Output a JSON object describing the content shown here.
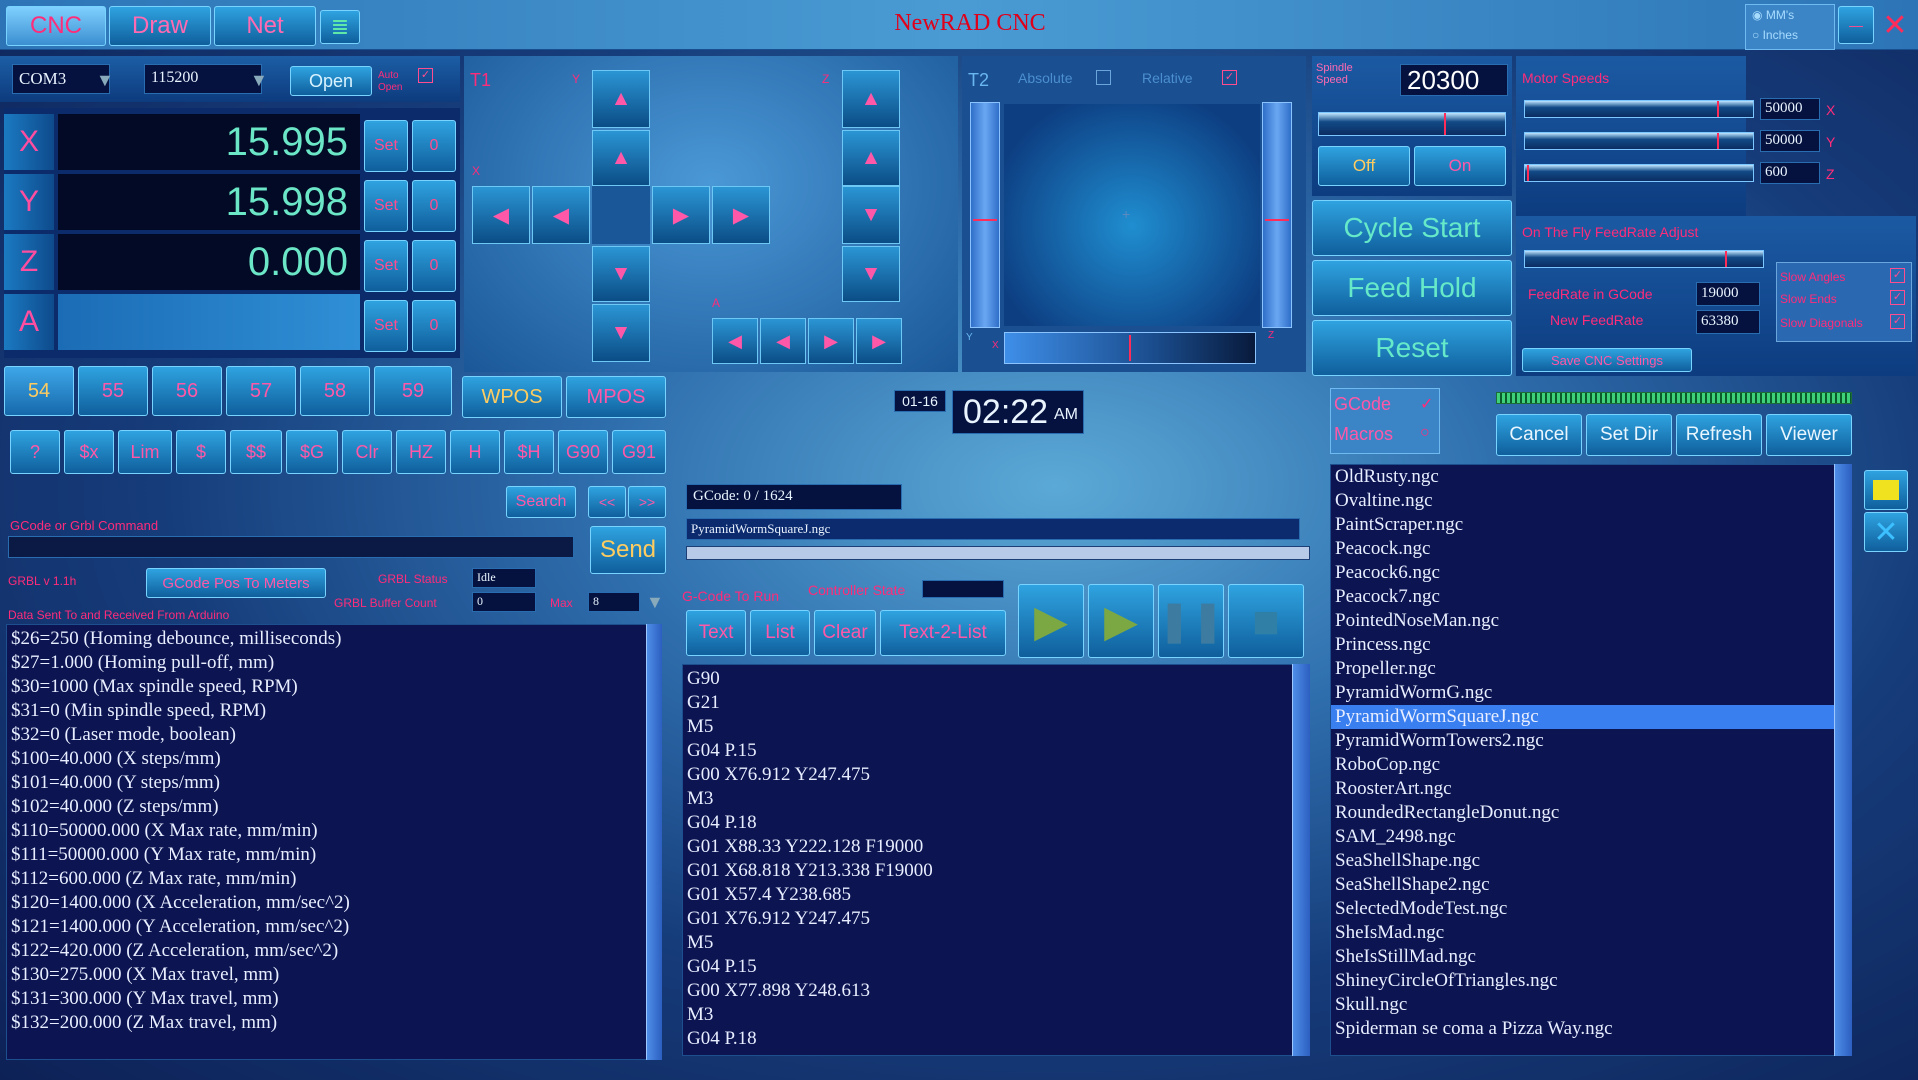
{
  "title": "NewRAD CNC",
  "tabs": [
    "CNC",
    "Draw",
    "Net"
  ],
  "units": {
    "mm": "MM's",
    "inches": "Inches"
  },
  "connection": {
    "port": "COM3",
    "baud": "115200",
    "open": "Open",
    "auto_open": "Auto Open"
  },
  "axes": [
    {
      "name": "X",
      "value": "15.995",
      "set": "Set",
      "zero": "0"
    },
    {
      "name": "Y",
      "value": "15.998",
      "set": "Set",
      "zero": "0"
    },
    {
      "name": "Z",
      "value": "0.000",
      "set": "Set",
      "zero": "0"
    },
    {
      "name": "A",
      "value": "",
      "set": "Set",
      "zero": "0"
    }
  ],
  "wcs": [
    "54",
    "55",
    "56",
    "57",
    "58",
    "59"
  ],
  "wpos": "WPOS",
  "mpos": "MPOS",
  "cmd_buttons": [
    "?",
    "$x",
    "Lim",
    "$",
    "$$",
    "$G",
    "Clr",
    "HZ",
    "H",
    "$H",
    "G90",
    "G91"
  ],
  "jog": {
    "t1": "T1",
    "t2": "T2",
    "y": "Y",
    "x": "X",
    "z": "Z",
    "a": "A",
    "absolute": "Absolute",
    "relative": "Relative"
  },
  "spindle": {
    "label": "Spindle Speed",
    "value": "20300",
    "off": "Off",
    "on": "On",
    "level": 0.68
  },
  "motor": {
    "label": "Motor Speeds",
    "rows": [
      {
        "value": "50000",
        "axis": "X"
      },
      {
        "value": "50000",
        "axis": "Y"
      },
      {
        "value": "600",
        "axis": "Z"
      }
    ]
  },
  "cycle": {
    "start": "Cycle Start",
    "hold": "Feed Hold",
    "reset": "Reset"
  },
  "feed": {
    "adjust": "On The Fly FeedRate Adjust",
    "in_gcode_label": "FeedRate in GCode",
    "in_gcode": "19000",
    "new_label": "New FeedRate",
    "new": "63380",
    "save": "Save CNC Settings",
    "slow_angles": "Slow Angles",
    "slow_ends": "Slow Ends",
    "slow_diagonals": "Slow Diagonals"
  },
  "search": {
    "button": "Search",
    "prev": "<<",
    "next": ">>"
  },
  "command": {
    "label": "GCode or Grbl Command",
    "send": "Send"
  },
  "grbl": {
    "version": "GRBL v 1.1h",
    "pos_to_meters": "GCode Pos To Meters",
    "status_label": "GRBL Status",
    "status": "Idle",
    "buffer_label": "GRBL Buffer Count",
    "buffer": "0",
    "max_label": "Max",
    "max": "8"
  },
  "data_label": "Data Sent To and Received From Arduino",
  "console": [
    "$26=250 (Homing debounce, milliseconds)",
    "$27=1.000 (Homing pull-off, mm)",
    "$30=1000 (Max spindle speed, RPM)",
    "$31=0 (Min spindle speed, RPM)",
    "$32=0 (Laser mode, boolean)",
    "$100=40.000 (X steps/mm)",
    "$101=40.000 (Y steps/mm)",
    "$102=40.000 (Z steps/mm)",
    "$110=50000.000 (X Max rate, mm/min)",
    "$111=50000.000 (Y Max rate, mm/min)",
    "$112=600.000 (Z Max rate, mm/min)",
    "$120=1400.000 (X Acceleration, mm/sec^2)",
    "$121=1400.000 (Y Acceleration, mm/sec^2)",
    "$122=420.000 (Z Acceleration, mm/sec^2)",
    "$130=275.000 (X Max travel, mm)",
    "$131=300.000 (Y Max travel, mm)",
    "$132=200.000 (Z Max travel, mm)"
  ],
  "clock": {
    "date": "01-16",
    "time": "02:22",
    "ampm": "AM"
  },
  "gcode": {
    "progress": "GCode: 0 / 1624",
    "file": "PyramidWormSquareJ.ngc",
    "to_run": "G-Code To Run",
    "controller_state": "Controller State",
    "text": "Text",
    "list": "List",
    "clear": "Clear",
    "text2list": "Text-2-List",
    "lines": [
      "G90",
      "G21",
      "M5",
      "G04 P.15",
      "G00 X76.912 Y247.475",
      "M3",
      "G04 P.18",
      "G01 X88.33 Y222.128 F19000",
      "G01 X68.818 Y213.338 F19000",
      "G01 X57.4 Y238.685",
      "G01 X76.912 Y247.475",
      "M5",
      "G04 P.15",
      "G00 X77.898 Y248.613",
      "M3",
      "G04 P.18"
    ]
  },
  "files": {
    "gcode": "GCode",
    "macros": "Macros",
    "cancel": "Cancel",
    "set_dir": "Set Dir",
    "refresh": "Refresh",
    "viewer": "Viewer",
    "items": [
      "OldRusty.ngc",
      "Ovaltine.ngc",
      "PaintScraper.ngc",
      "Peacock.ngc",
      "Peacock6.ngc",
      "Peacock7.ngc",
      "PointedNoseMan.ngc",
      "Princess.ngc",
      "Propeller.ngc",
      "PyramidWormG.ngc",
      "PyramidWormSquareJ.ngc",
      "PyramidWormTowers2.ngc",
      "RoboCop.ngc",
      "RoosterArt.ngc",
      "RoundedRectangleDonut.ngc",
      "SAM_2498.ngc",
      "SeaShellShape.ngc",
      "SeaShellShape2.ngc",
      "SelectedModeTest.ngc",
      "SheIsMad.ngc",
      "SheIsStillMad.ngc",
      "ShineyCircleOfTriangles.ngc",
      "Skull.ngc",
      "Spiderman se coma a Pizza Way.ngc"
    ],
    "selected": "PyramidWormSquareJ.ngc"
  },
  "colors": {
    "accent": "#ff2c7a",
    "value": "#6be6c6",
    "selected": "#3a7ff0"
  }
}
